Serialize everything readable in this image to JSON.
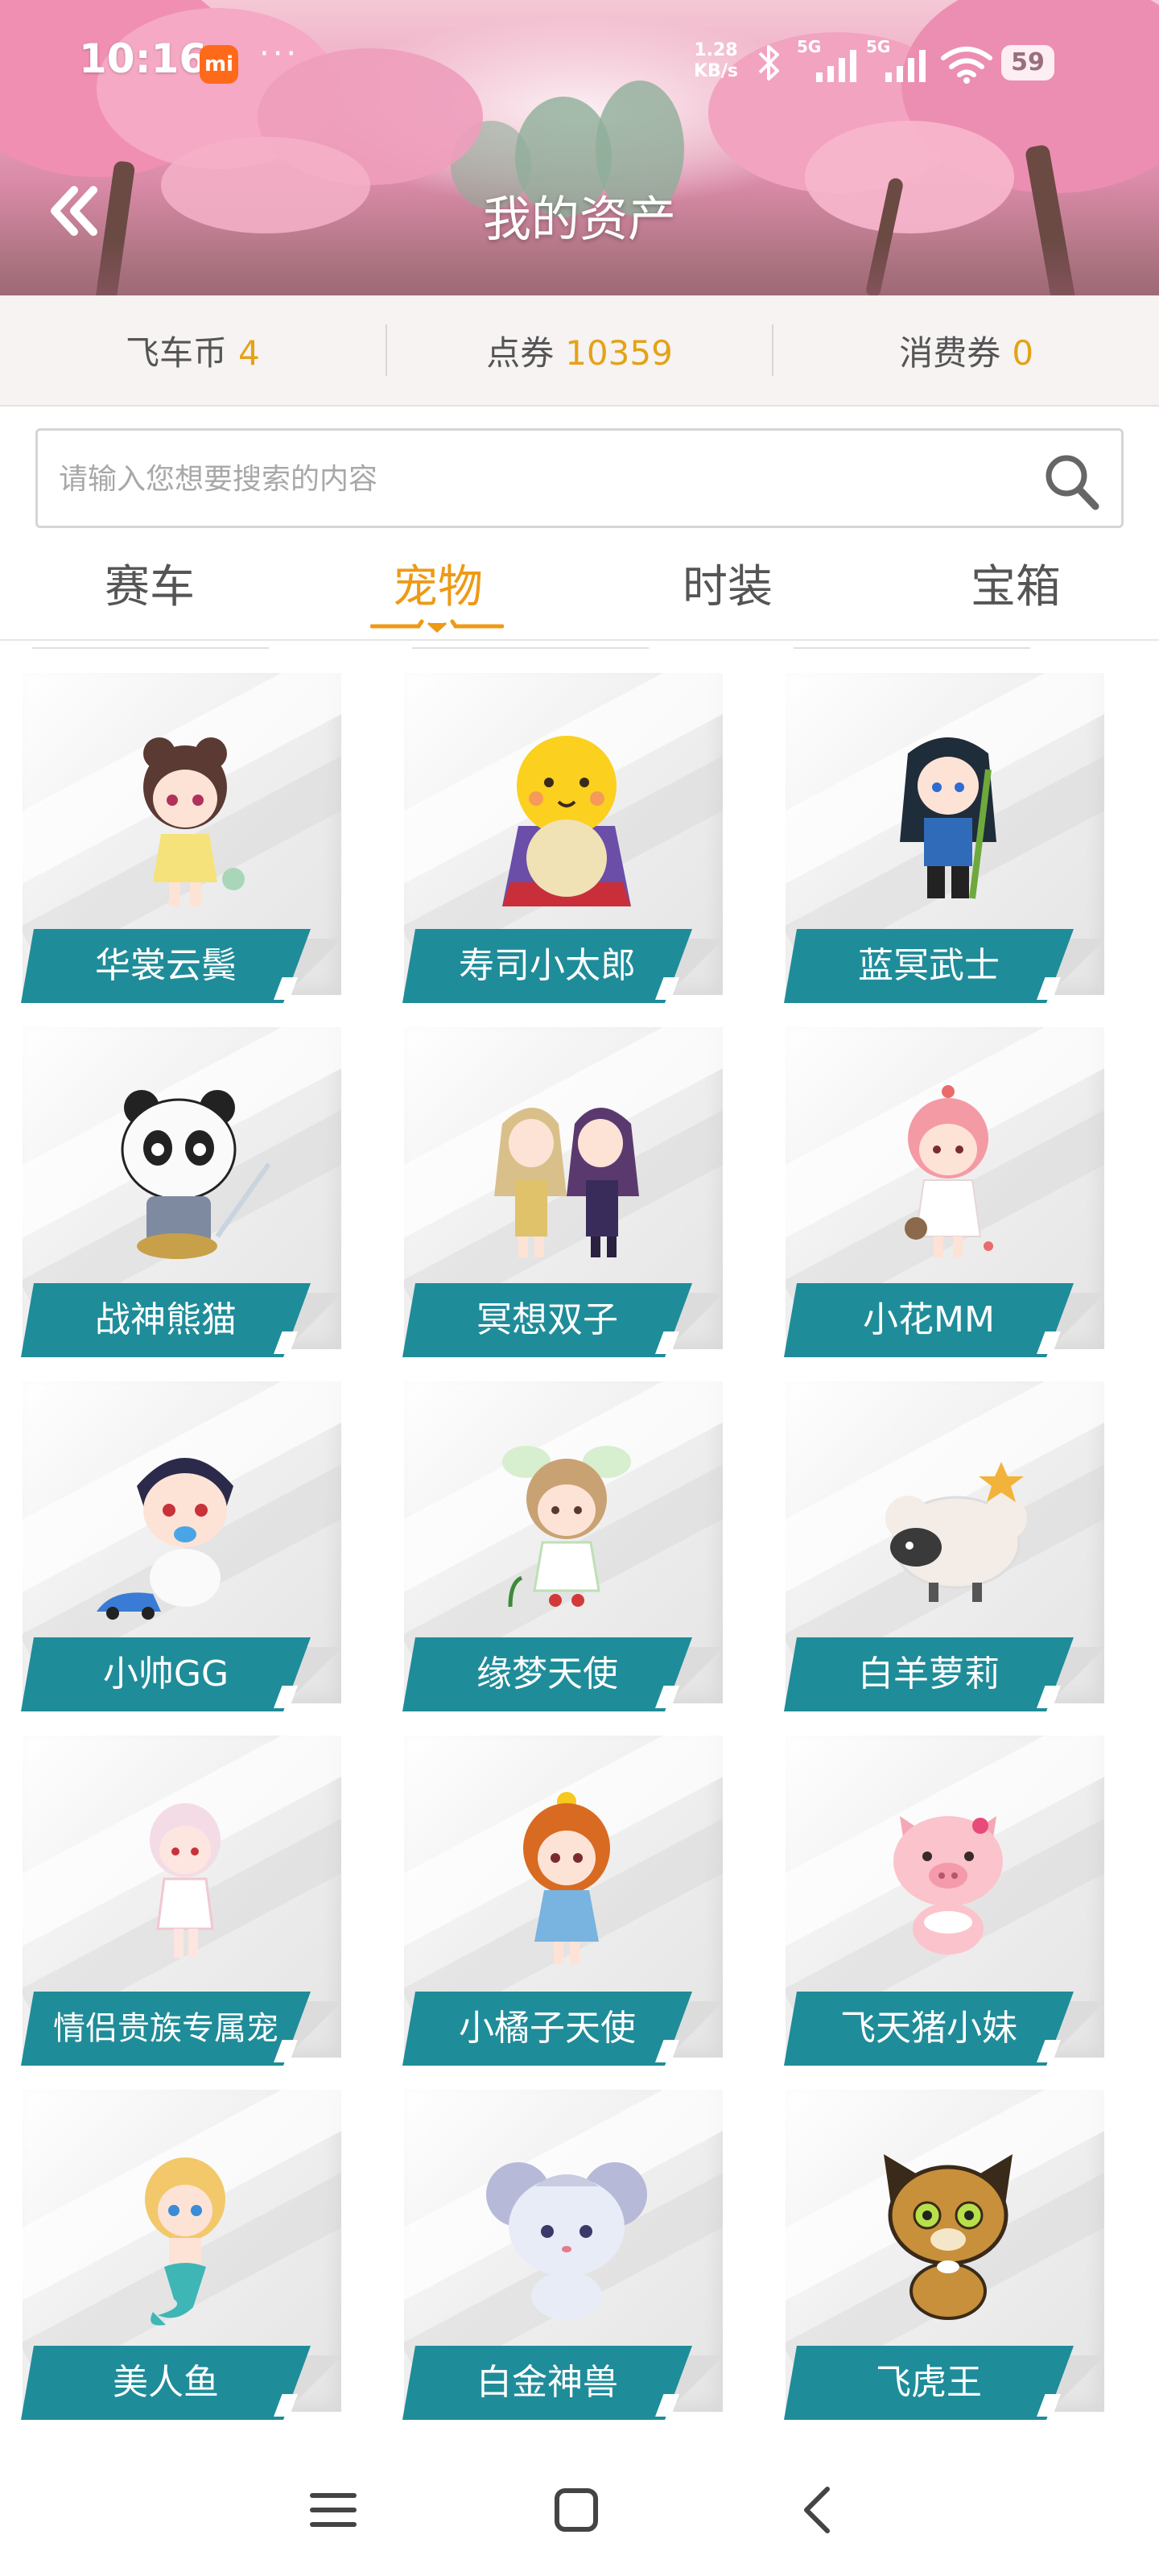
{
  "status_bar": {
    "time": "10:16",
    "app_badge": "mi",
    "more": "···",
    "net_speed_value": "1.28",
    "net_speed_unit": "KB/s",
    "network_1": "5G",
    "network_2": "5G",
    "battery": "59",
    "icons": [
      "bluetooth-icon",
      "signal-icon",
      "signal-icon",
      "wifi-icon",
      "battery-icon"
    ]
  },
  "header": {
    "title": "我的资产",
    "back_icon": "double-chevron-left-icon"
  },
  "currencies": [
    {
      "label": "飞车币",
      "value": "4"
    },
    {
      "label": "点券",
      "value": "10359"
    },
    {
      "label": "消费券",
      "value": "0"
    }
  ],
  "search": {
    "placeholder": "请输入您想要搜索的内容",
    "value": "",
    "icon": "search-icon"
  },
  "tabs": {
    "items": [
      "赛车",
      "宠物",
      "时装",
      "宝箱"
    ],
    "active_index": 1
  },
  "pets": [
    {
      "name": "华裳云鬓",
      "icon": "pet-girl-icon"
    },
    {
      "name": "寿司小太郎",
      "icon": "pet-chick-icon"
    },
    {
      "name": "蓝冥武士",
      "icon": "pet-warrior-icon"
    },
    {
      "name": "战神熊猫",
      "icon": "pet-panda-icon"
    },
    {
      "name": "冥想双子",
      "icon": "pet-twins-icon"
    },
    {
      "name": "小花MM",
      "icon": "pet-girl-icon"
    },
    {
      "name": "小帅GG",
      "icon": "pet-baby-icon"
    },
    {
      "name": "缘梦天使",
      "icon": "pet-angel-icon"
    },
    {
      "name": "白羊萝莉",
      "icon": "pet-sheep-icon"
    },
    {
      "name": "情侣贵族专属宠",
      "icon": "pet-girl-icon"
    },
    {
      "name": "小橘子天使",
      "icon": "pet-girl-icon"
    },
    {
      "name": "飞天猪小妹",
      "icon": "pet-pig-icon"
    },
    {
      "name": "美人鱼",
      "icon": "pet-mermaid-icon"
    },
    {
      "name": "白金神兽",
      "icon": "pet-mouse-icon"
    },
    {
      "name": "飞虎王",
      "icon": "pet-tiger-icon"
    }
  ],
  "colors": {
    "accent_orange": "#ee9a16",
    "value_orange": "#e5a217",
    "label_teal": "#1f8c99",
    "tab_text": "#555555"
  },
  "navbar": {
    "icons": [
      "menu-icon",
      "home-square-icon",
      "back-chevron-icon"
    ]
  }
}
